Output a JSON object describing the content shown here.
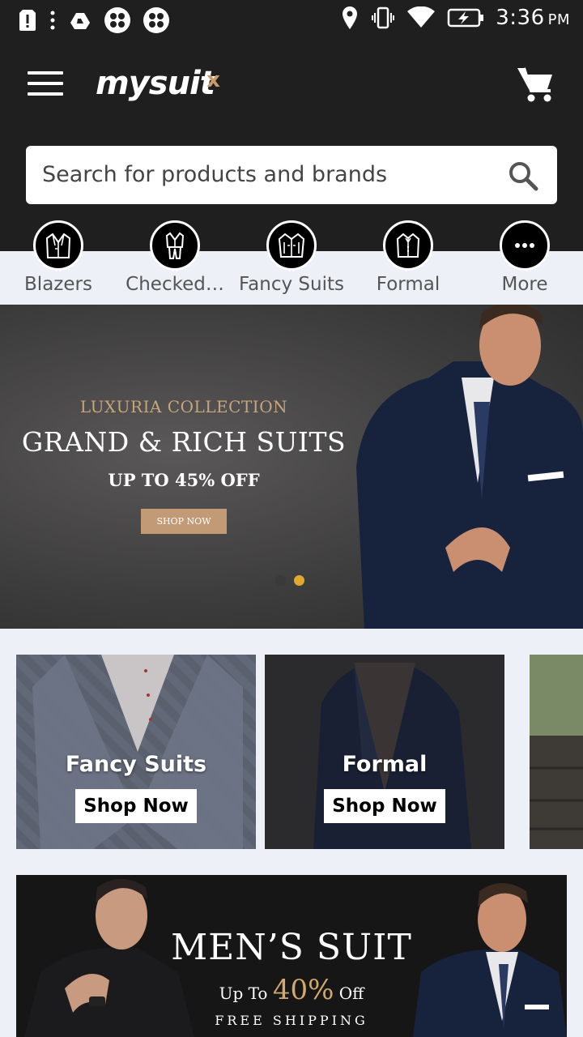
{
  "status_bar": {
    "time": "3:36",
    "ampm": "PM"
  },
  "app": {
    "logo": "mysuit",
    "logo_mark": "x"
  },
  "search": {
    "placeholder": "Search for products and brands"
  },
  "categories": [
    {
      "label": "Blazers",
      "icon": "blazer-icon"
    },
    {
      "label": "Checked…",
      "icon": "checked-suit-icon"
    },
    {
      "label": "Fancy Suits",
      "icon": "fancy-suit-icon"
    },
    {
      "label": "Formal",
      "icon": "formal-icon"
    },
    {
      "label": "More",
      "icon": "more-dots-icon"
    }
  ],
  "hero": {
    "subtitle": "LUXURIA COLLECTION",
    "title": "GRAND & RICH SUITS",
    "offer": "UP TO 45% OFF",
    "cta": "SHOP NOW",
    "slides": 2,
    "active_slide": 2
  },
  "tiles": [
    {
      "label": "Fancy Suits",
      "button": "Shop Now"
    },
    {
      "label": "Formal",
      "button": "Shop Now"
    }
  ],
  "banner2": {
    "title": "MEN’S SUIT",
    "up_to": "Up To",
    "percent": "40%",
    "off": "Off",
    "shipping": "FREE SHIPPING"
  },
  "colors": {
    "header_bg": "#1f1f1f",
    "page_bg": "#eef0f8",
    "accent_gold": "#e2a72e",
    "cta_tan": "#c29b76"
  }
}
